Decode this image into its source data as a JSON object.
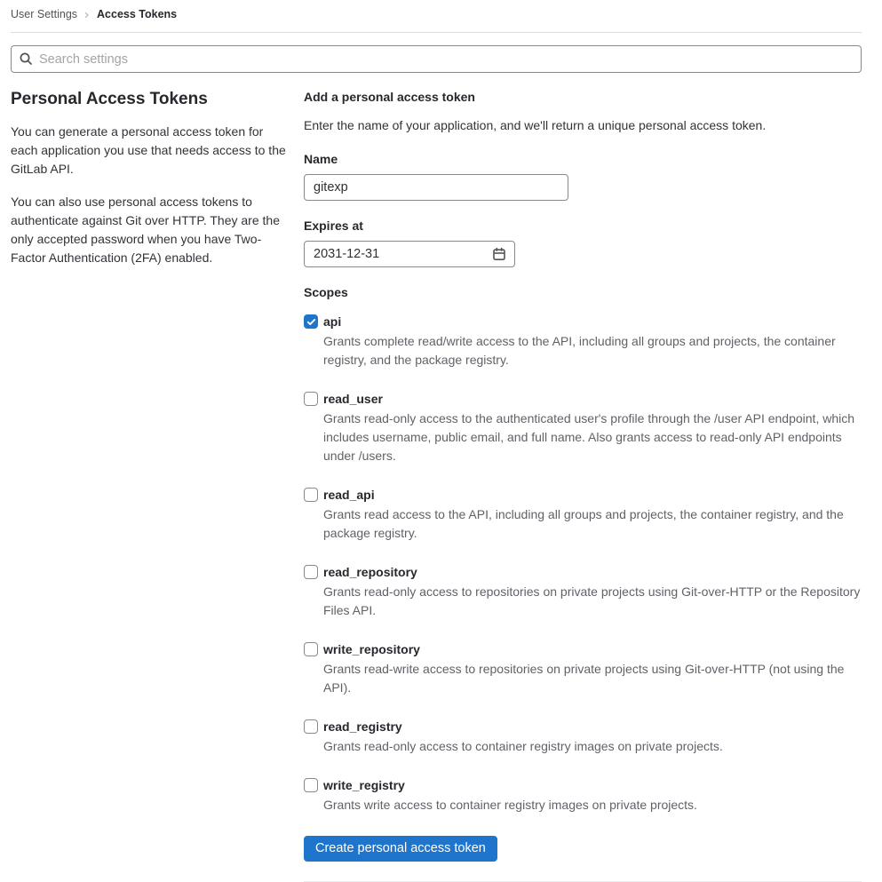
{
  "breadcrumb": {
    "parent": "User Settings",
    "current": "Access Tokens"
  },
  "search": {
    "placeholder": "Search settings"
  },
  "sidebar": {
    "title": "Personal Access Tokens",
    "paragraph1": "You can generate a personal access token for each application you use that needs access to the GitLab API.",
    "paragraph2": "You can also use personal access tokens to authenticate against Git over HTTP. They are the only accepted password when you have Two-Factor Authentication (2FA) enabled."
  },
  "form": {
    "title": "Add a personal access token",
    "description": "Enter the name of your application, and we'll return a unique personal access token.",
    "name_label": "Name",
    "name_value": "gitexp",
    "expires_label": "Expires at",
    "expires_value": "2031-12-31",
    "scopes_label": "Scopes",
    "scopes": [
      {
        "name": "api",
        "checked": true,
        "description": "Grants complete read/write access to the API, including all groups and projects, the container registry, and the package registry."
      },
      {
        "name": "read_user",
        "checked": false,
        "description": "Grants read-only access to the authenticated user's profile through the /user API endpoint, which includes username, public email, and full name. Also grants access to read-only API endpoints under /users."
      },
      {
        "name": "read_api",
        "checked": false,
        "description": "Grants read access to the API, including all groups and projects, the container registry, and the package registry."
      },
      {
        "name": "read_repository",
        "checked": false,
        "description": "Grants read-only access to repositories on private projects using Git-over-HTTP or the Repository Files API."
      },
      {
        "name": "write_repository",
        "checked": false,
        "description": "Grants read-write access to repositories on private projects using Git-over-HTTP (not using the API)."
      },
      {
        "name": "read_registry",
        "checked": false,
        "description": "Grants read-only access to container registry images on private projects."
      },
      {
        "name": "write_registry",
        "checked": false,
        "description": "Grants write access to container registry images on private projects."
      }
    ],
    "submit_label": "Create personal access token"
  },
  "colors": {
    "accent": "#1f75cb",
    "text_primary": "#28272d",
    "text_secondary": "#626168",
    "input_border": "#89888d",
    "divider_top": "#dcdcde",
    "divider_bottom": "#ececef"
  }
}
